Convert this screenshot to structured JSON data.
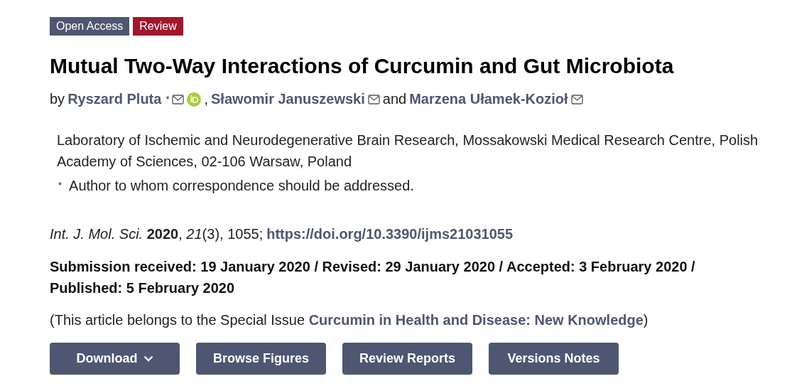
{
  "badges": [
    {
      "label": "Open Access",
      "kind": "access"
    },
    {
      "label": "Review",
      "kind": "type"
    }
  ],
  "title": "Mutual Two-Way Interactions of Curcumin and Gut Microbiota",
  "authors_prefix": "by",
  "authors": [
    {
      "name": "Ryszard Pluta",
      "corresponding": "*",
      "orcid": true,
      "separator": ","
    },
    {
      "name": "Sławomir Januszewski",
      "orcid": false,
      "separator": "and"
    },
    {
      "name": "Marzena Ułamek-Kozioł",
      "orcid": false
    }
  ],
  "affiliation": "Laboratory of Ischemic and Neurodegenerative Brain Research, Mossakowski Medical Research Centre, Polish Academy of Sciences, 02-106 Warsaw, Poland",
  "correspondence": {
    "mark": "*",
    "text": "Author to whom correspondence should be addressed."
  },
  "citation": {
    "text": "*Int. J. Mol. Sci.* **2020**, *21*(3), 1055;",
    "doi": "https://doi.org/10.3390/ijms21031055"
  },
  "dates": "Submission received: 19 January 2020 / Revised: 29 January 2020 / Accepted: 3 February 2020 / Published: 5 February 2020",
  "special_issue": {
    "prefix": "(This article belongs to the Special Issue",
    "link": "Curcumin in Health and Disease: New Knowledge",
    "suffix": ")"
  },
  "buttons": [
    {
      "label": "Download",
      "kind": "dropdown"
    },
    {
      "label": "Browse Figures",
      "kind": "plain"
    },
    {
      "label": "Review Reports",
      "kind": "plain"
    },
    {
      "label": "Versions Notes",
      "kind": "plain"
    }
  ]
}
